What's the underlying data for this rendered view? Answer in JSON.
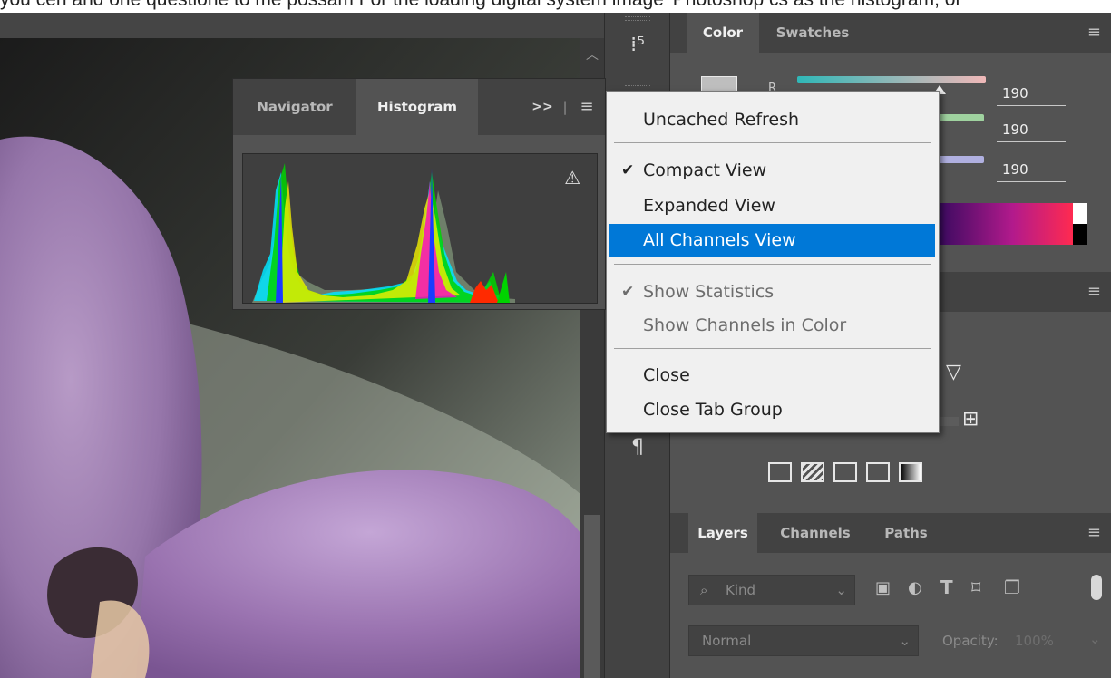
{
  "caption": {
    "text": "you cen and one questione to me possam For the loading digital system image 'Photoshop cs as the histogram, or"
  },
  "histogram_panel": {
    "tabs": [
      {
        "label": "Navigator"
      },
      {
        "label": "Histogram"
      }
    ],
    "expand_label": ">>",
    "warning_icon": "warning-icon"
  },
  "context_menu": {
    "items": [
      {
        "label": "Uncached Refresh",
        "checked": false,
        "disabled": false,
        "highlighted": false
      },
      {
        "label": "Compact View",
        "checked": true,
        "disabled": false,
        "highlighted": false
      },
      {
        "label": "Expanded View",
        "checked": false,
        "disabled": false,
        "highlighted": false
      },
      {
        "label": "All Channels View",
        "checked": false,
        "disabled": false,
        "highlighted": true
      },
      {
        "label": "Show Statistics",
        "checked": true,
        "disabled": true,
        "highlighted": false
      },
      {
        "label": "Show Channels in Color",
        "checked": false,
        "disabled": true,
        "highlighted": false
      },
      {
        "label": "Close",
        "checked": false,
        "disabled": false,
        "highlighted": false
      },
      {
        "label": "Close Tab Group",
        "checked": false,
        "disabled": false,
        "highlighted": false
      }
    ],
    "check_glyph": "✔"
  },
  "color_panel": {
    "tabs": [
      {
        "label": "Color"
      },
      {
        "label": "Swatches"
      }
    ],
    "channel_label_r": "R",
    "values": {
      "r": "190",
      "g": "190",
      "b": "190"
    }
  },
  "layers_panel": {
    "tabs": [
      {
        "label": "Layers"
      },
      {
        "label": "Channels"
      },
      {
        "label": "Paths"
      }
    ],
    "kind_placeholder": "Kind",
    "blend_mode": "Normal",
    "opacity_label": "Opacity:",
    "opacity_value": "100%"
  },
  "colors": {
    "highlight": "#0078d7",
    "panel_bg": "#535353",
    "tab_bg": "#424242",
    "menu_bg": "#f0f0f0"
  }
}
